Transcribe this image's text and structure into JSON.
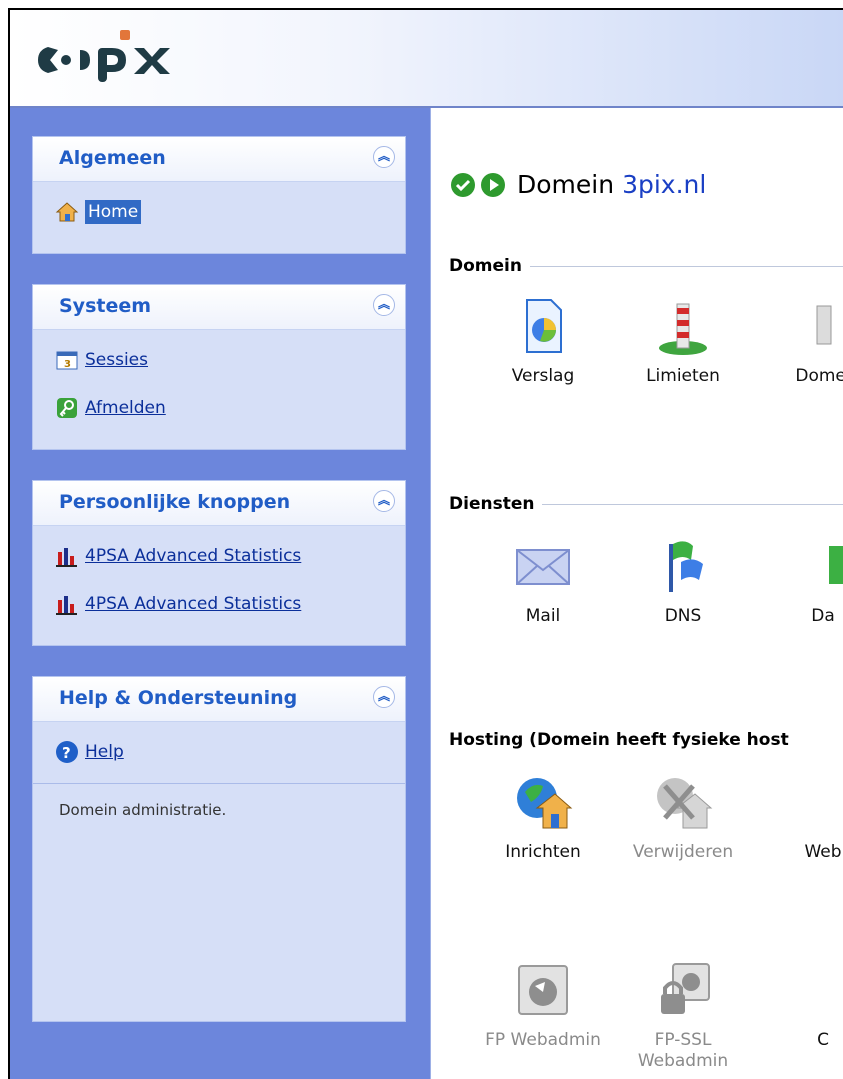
{
  "brand": {
    "logo_text": "3pix"
  },
  "sidebar": {
    "panels": [
      {
        "title": "Algemeen",
        "items": [
          {
            "label": "Home",
            "icon": "home-icon",
            "selected": true
          }
        ]
      },
      {
        "title": "Systeem",
        "items": [
          {
            "label": "Sessies",
            "icon": "sessions-icon"
          },
          {
            "label": "Afmelden",
            "icon": "logout-icon"
          }
        ]
      },
      {
        "title": "Persoonlijke knoppen",
        "items": [
          {
            "label": "4PSA Advanced Statistics",
            "icon": "statistics-icon"
          },
          {
            "label": "4PSA Advanced Statistics",
            "icon": "statistics-icon"
          }
        ]
      },
      {
        "title": "Help & Ondersteuning",
        "items": [
          {
            "label": "Help",
            "icon": "help-icon"
          }
        ],
        "description": "Domein administratie."
      }
    ]
  },
  "main": {
    "title_prefix": "Domein",
    "domain": "3pix.nl",
    "sections": [
      {
        "title": "Domein",
        "tools": [
          {
            "label": "Verslag",
            "icon": "report-icon"
          },
          {
            "label": "Limieten",
            "icon": "limits-icon"
          },
          {
            "label": "Domei",
            "icon": "domain-icon"
          }
        ]
      },
      {
        "title": "Diensten",
        "tools": [
          {
            "label": "Mail",
            "icon": "mail-icon"
          },
          {
            "label": "DNS",
            "icon": "dns-icon"
          },
          {
            "label": "Da",
            "icon": "database-icon"
          }
        ]
      },
      {
        "title": "Hosting (Domein heeft fysieke host",
        "tools": [
          {
            "label": "Inrichten",
            "icon": "setup-icon"
          },
          {
            "label": "Verwijderen",
            "icon": "remove-icon",
            "disabled": true
          },
          {
            "label": "Web",
            "icon": "web-icon"
          },
          {
            "label": "FP Webadmin",
            "icon": "fp-webadmin-icon",
            "disabled": true
          },
          {
            "label": "FP-SSL Webadmin",
            "icon": "fp-ssl-webadmin-icon",
            "disabled": true
          },
          {
            "label": "C",
            "icon": "c-icon"
          }
        ]
      }
    ]
  },
  "colors": {
    "sidebar_bg": "#6c86dc",
    "panel_title": "#215dc6",
    "domain_link": "#1a3fc4",
    "ok_green": "#2e9a2e"
  }
}
